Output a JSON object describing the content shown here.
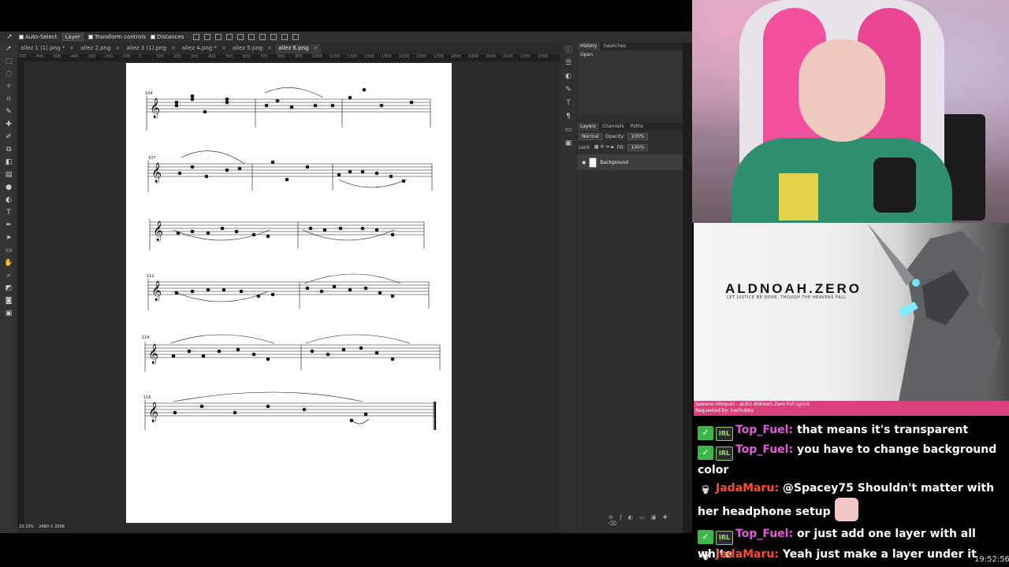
{
  "editor": {
    "options": {
      "auto_select_label": "Auto-Select",
      "layer_select": "Layer",
      "transform_controls_label": "Transform controls",
      "distances_label": "Distances"
    },
    "tabs": [
      {
        "label": "aliez 1 (1).png *",
        "active": false
      },
      {
        "label": "aliez 2.png",
        "active": false
      },
      {
        "label": "aliez 3 (1).png",
        "active": false
      },
      {
        "label": "aliez 4.png *",
        "active": false
      },
      {
        "label": "aliez 5.png",
        "active": false
      },
      {
        "label": "aliez 6.png",
        "active": true
      }
    ],
    "ruler_ticks": [
      "-700",
      "-600",
      "-500",
      "-400",
      "-300",
      "-200",
      "-100",
      "0",
      "100",
      "200",
      "300",
      "400",
      "500",
      "600",
      "700",
      "800",
      "900",
      "1000",
      "1100",
      "1200",
      "1300",
      "1400",
      "1500",
      "1600",
      "1700",
      "1800",
      "1900",
      "2000",
      "2100",
      "2200",
      "2300",
      "2400",
      "2500",
      "2600",
      "2700",
      "2800",
      "2900",
      "3000",
      "3100",
      "3200"
    ],
    "status": {
      "zoom": "33.33%",
      "size": "2480 × 3508"
    },
    "measures": [
      "104",
      "107",
      "112",
      "114",
      "116"
    ],
    "history": {
      "tab": "History",
      "tab2": "Swatches",
      "items": [
        "Open"
      ]
    },
    "layers": {
      "tabs": [
        "Layers",
        "Channels",
        "Paths"
      ],
      "blend_mode": "Normal",
      "opacity_label": "Opacity:",
      "opacity": "100%",
      "lock_label": "Lock:",
      "fill_label": "Fill:",
      "fill": "100%",
      "layer_name": "Background"
    }
  },
  "nowplaying": {
    "title": "ALDNOAH.ZERO",
    "tagline": "LET JUSTICE BE DONE, THOUGH THE HEAVENS FALL",
    "track": "Sawano Hiroyuki - aLIEz Aldnoah.Zero Full Lyrics",
    "requested_by": "Requested by: hachubby"
  },
  "chat": {
    "messages": [
      {
        "user": "Top_Fuel:",
        "text": "that means it's transparent",
        "badges": [
          "check",
          "irl"
        ]
      },
      {
        "user": "Top_Fuel:",
        "text": "you have to change background color",
        "badges": [
          "check",
          "irl"
        ]
      },
      {
        "user": "JadaMaru:",
        "text": "@Spacey75 Shouldn't matter with her headphone setup",
        "badges": [
          "skull"
        ]
      },
      {
        "user": "Top_Fuel:",
        "text": "or just add one layer with all white",
        "badges": [
          "check",
          "irl"
        ]
      },
      {
        "user": "JadaMaru:",
        "text": "Yeah just make a layer under it",
        "badges": [
          "skull"
        ]
      }
    ]
  },
  "clock": "19:52:56"
}
